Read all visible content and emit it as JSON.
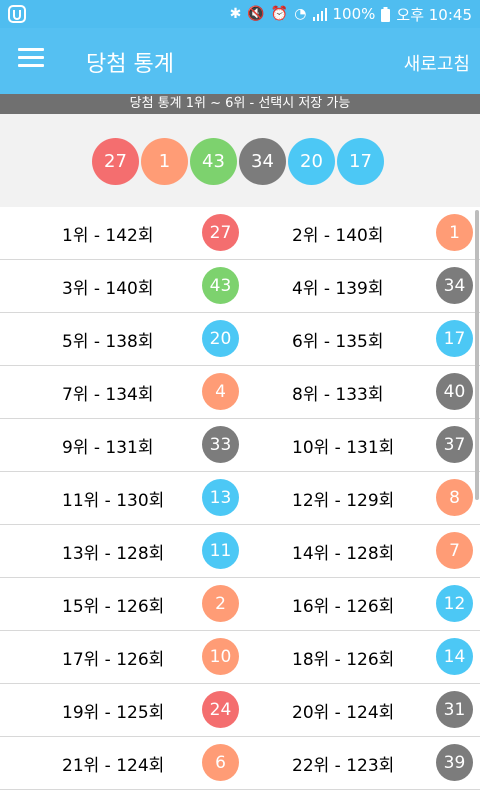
{
  "colors": {
    "red": "#f46e6f",
    "orange": "#ff9c76",
    "green": "#7dd26e",
    "gray": "#7c7c7c",
    "blue": "#4cc8f5"
  },
  "status": {
    "battery": "100%",
    "time": "오후 10:45",
    "left_icon": "app-notify-icon",
    "icons": [
      "bluetooth-icon",
      "mute-icon",
      "alarm-icon",
      "wifi-icon",
      "signal-icon",
      "battery-icon"
    ]
  },
  "appbar": {
    "title": "당첨 통계",
    "refresh": "새로고침"
  },
  "banner": "당첨 통계 1위 ~ 6위 - 선택시 저장 가능",
  "top_numbers": [
    {
      "num": "27",
      "color": "red"
    },
    {
      "num": "1",
      "color": "orange"
    },
    {
      "num": "43",
      "color": "green"
    },
    {
      "num": "34",
      "color": "gray"
    },
    {
      "num": "20",
      "color": "blue"
    },
    {
      "num": "17",
      "color": "blue"
    }
  ],
  "rows": [
    {
      "left": {
        "rank": "1위 - 142회",
        "num": "27",
        "color": "red"
      },
      "right": {
        "rank": "2위 - 140회",
        "num": "1",
        "color": "orange"
      }
    },
    {
      "left": {
        "rank": "3위 - 140회",
        "num": "43",
        "color": "green"
      },
      "right": {
        "rank": "4위 - 139회",
        "num": "34",
        "color": "gray"
      }
    },
    {
      "left": {
        "rank": "5위 - 138회",
        "num": "20",
        "color": "blue"
      },
      "right": {
        "rank": "6위 - 135회",
        "num": "17",
        "color": "blue"
      }
    },
    {
      "left": {
        "rank": "7위 - 134회",
        "num": "4",
        "color": "orange"
      },
      "right": {
        "rank": "8위 - 133회",
        "num": "40",
        "color": "gray"
      }
    },
    {
      "left": {
        "rank": "9위 - 131회",
        "num": "33",
        "color": "gray"
      },
      "right": {
        "rank": "10위 - 131회",
        "num": "37",
        "color": "gray"
      }
    },
    {
      "left": {
        "rank": "11위 - 130회",
        "num": "13",
        "color": "blue"
      },
      "right": {
        "rank": "12위 - 129회",
        "num": "8",
        "color": "orange"
      }
    },
    {
      "left": {
        "rank": "13위 - 128회",
        "num": "11",
        "color": "blue"
      },
      "right": {
        "rank": "14위 - 128회",
        "num": "7",
        "color": "orange"
      }
    },
    {
      "left": {
        "rank": "15위 - 126회",
        "num": "2",
        "color": "orange"
      },
      "right": {
        "rank": "16위 - 126회",
        "num": "12",
        "color": "blue"
      }
    },
    {
      "left": {
        "rank": "17위 - 126회",
        "num": "10",
        "color": "orange"
      },
      "right": {
        "rank": "18위 - 126회",
        "num": "14",
        "color": "blue"
      }
    },
    {
      "left": {
        "rank": "19위 - 125회",
        "num": "24",
        "color": "red"
      },
      "right": {
        "rank": "20위 - 124회",
        "num": "31",
        "color": "gray"
      }
    },
    {
      "left": {
        "rank": "21위 - 124회",
        "num": "6",
        "color": "orange"
      },
      "right": {
        "rank": "22위 - 123회",
        "num": "39",
        "color": "gray"
      }
    }
  ]
}
